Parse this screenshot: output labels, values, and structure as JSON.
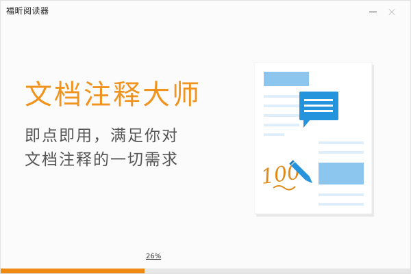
{
  "window": {
    "title": "福昕阅读器"
  },
  "splash": {
    "headline": "文档注释大师",
    "subtitle_line1": "即点即用，满足你对",
    "subtitle_line2": "文档注释的一切需求"
  },
  "illustration": {
    "score_text": "100",
    "icons": [
      "document-icon",
      "comment-bubble-icon",
      "pen-icon"
    ]
  },
  "progress": {
    "label": "26%",
    "value": 0.35
  },
  "colors": {
    "accent": "#f0931f",
    "progress_fill": "#ee8a14",
    "progress_track": "#e6e6e6",
    "doc_blue": "#8cc6ef",
    "doc_line": "#deeefa",
    "bubble_blue": "#2694dc"
  }
}
